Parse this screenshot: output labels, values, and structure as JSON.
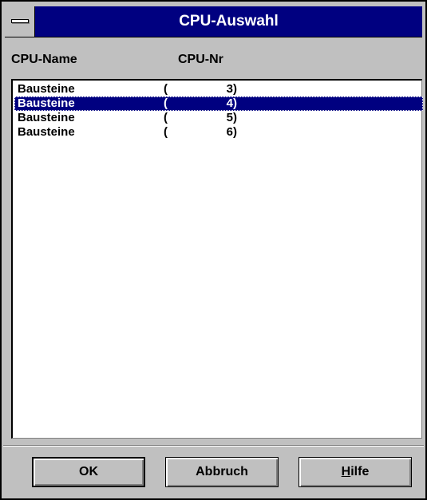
{
  "window": {
    "title": "CPU-Auswahl"
  },
  "columns": {
    "name": "CPU-Name",
    "nr": "CPU-Nr"
  },
  "list": {
    "rows": [
      {
        "name": "Bausteine",
        "open": "(",
        "nr": "3",
        "close": ")"
      },
      {
        "name": "Bausteine",
        "open": "(",
        "nr": "4",
        "close": ")"
      },
      {
        "name": "Bausteine",
        "open": "(",
        "nr": "5",
        "close": ")"
      },
      {
        "name": "Bausteine",
        "open": "(",
        "nr": "6",
        "close": ")"
      }
    ],
    "selected_index": 1
  },
  "buttons": {
    "ok": "OK",
    "cancel": "Abbruch",
    "help_hotkey": "H",
    "help_rest": "ilfe"
  },
  "colors": {
    "titlebar": "#000080",
    "face": "#c0c0c0",
    "selection": "#000080"
  },
  "icons": {
    "system_menu": "system-menu-icon"
  }
}
